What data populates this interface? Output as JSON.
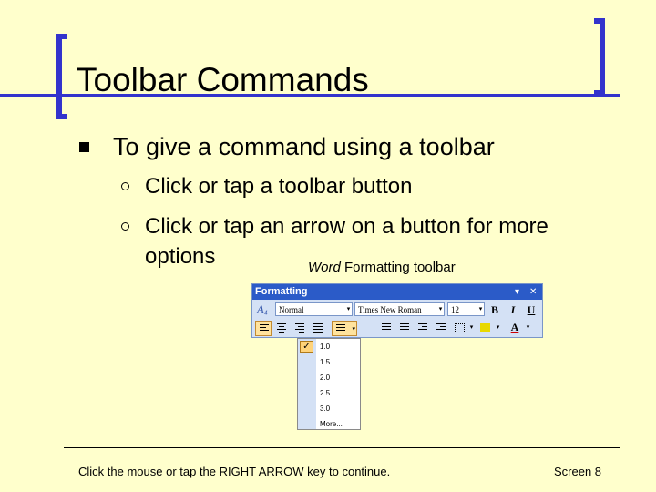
{
  "title": "Toolbar Commands",
  "main_bullet": "To give a command using a toolbar",
  "sub_bullets": [
    {
      "line1": "Click or tap a toolbar button"
    },
    {
      "line1": "Click or tap an arrow on a button for more",
      "line2": "options"
    }
  ],
  "caption": {
    "italic": "Word",
    "rest": " Formatting toolbar"
  },
  "toolbar": {
    "title": "Formatting",
    "style_value": "Normal",
    "font_value": "Times New Roman",
    "size_value": "12",
    "style_icon": "A₄",
    "bold": "B",
    "italic": "I",
    "underline": "U",
    "font_color": "A",
    "dropdown_arrow": "▾",
    "options_arrow": "▾",
    "close": "✕"
  },
  "line_spacing_menu": {
    "items": [
      "1.0",
      "1.5",
      "2.0",
      "2.5",
      "3.0",
      "More..."
    ],
    "checked_index": 0,
    "check_mark": "✓"
  },
  "footer": {
    "instruction": "Click the mouse or tap the RIGHT ARROW key to continue.",
    "screen": "Screen 8"
  },
  "colors": {
    "background": "#FFFFCC",
    "accent": "#3333CC",
    "toolbar_title": "#2B5BC8",
    "toolbar_body": "#D4E1F5"
  }
}
